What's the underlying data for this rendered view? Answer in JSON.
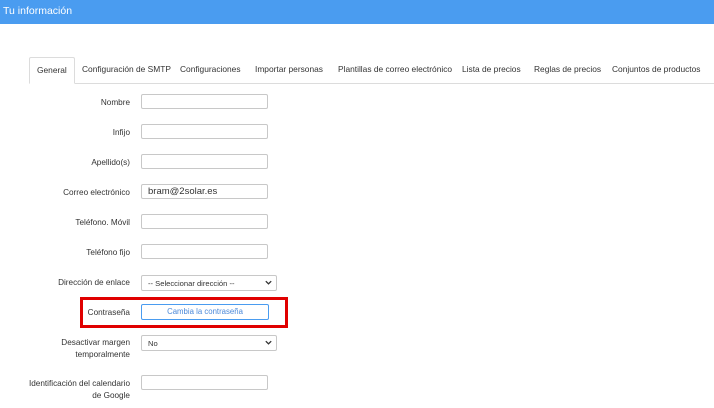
{
  "header": {
    "title": "Tu información"
  },
  "tabs": [
    {
      "label": "General"
    },
    {
      "label": "Configuración de SMTP"
    },
    {
      "label": "Configuraciones"
    },
    {
      "label": "Importar personas"
    },
    {
      "label": "Plantillas de correo electrónico"
    },
    {
      "label": "Lista de precios"
    },
    {
      "label": "Reglas de precios"
    },
    {
      "label": "Conjuntos de productos"
    }
  ],
  "form": {
    "nombre_label": "Nombre",
    "nombre_value": "",
    "infijo_label": "Infijo",
    "infijo_value": "",
    "apellido_label": "Apellido(s)",
    "apellido_value": "",
    "email_label": "Correo electrónico",
    "email_value": "bram@2solar.es",
    "movil_label": "Teléfono. Móvil",
    "movil_value": "",
    "fijo_label": "Teléfono fijo",
    "fijo_value": "",
    "direccion_label": "Dirección de enlace",
    "direccion_value": "-- Seleccionar dirección --",
    "password_label": "Contraseña",
    "password_button": "Cambia la contraseña",
    "margen_label_1": "Desactivar margen",
    "margen_label_2": "temporalmente",
    "margen_value": "No",
    "google_label_1": "Identificación del calendario",
    "google_label_2": "de Google",
    "google_value": ""
  },
  "colors": {
    "header_bg": "#4a9cf0",
    "highlight": "#e00000",
    "button_text": "#4a88d9"
  }
}
